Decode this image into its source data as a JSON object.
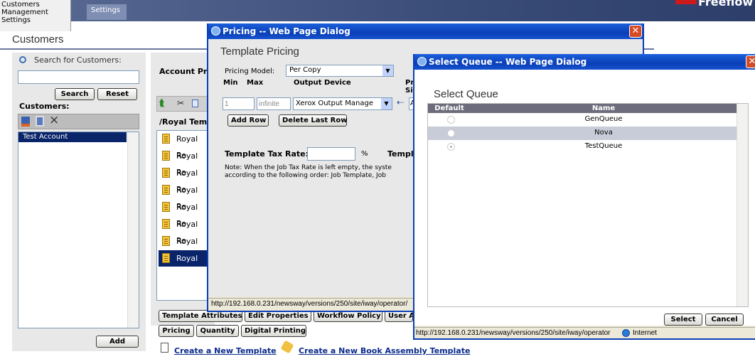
{
  "top_menu": {
    "items": [
      "Customers",
      "Management",
      "Settings"
    ],
    "settings_tab": "Settings",
    "brand_fragment": "Freeflow"
  },
  "page": {
    "title": "Customers"
  },
  "left_panel": {
    "search_label": "Search for Customers:",
    "search_value": "",
    "search_button": "Search",
    "reset_button": "Reset",
    "customers_label": "Customers:",
    "customers": [
      "Test Account"
    ],
    "add_button": "Add"
  },
  "middle_panel": {
    "account_header": "Account Pr",
    "path": "/Royal Tem",
    "templates": [
      "Royal Re",
      "Royal Re",
      "Royal Re",
      "Royal Re",
      "Royal Re",
      "Royal Re",
      "Royal Re",
      "Royal Re"
    ],
    "tabs_row1": [
      "Template Attributes",
      "Edit Properties",
      "Workflow Policy",
      "User A"
    ],
    "tabs_row2": [
      "Pricing",
      "Quantity",
      "Digital Printing"
    ],
    "create_template": "Create a New Template",
    "create_book": "Create a New Book Assembly Template"
  },
  "pricing_dialog": {
    "window_title": "Pricing -- Web Page Dialog",
    "heading": "Template Pricing",
    "model_label": "Pricing Model:",
    "model_value": "Per Copy",
    "col_min": "Min",
    "col_max": "Max",
    "col_device": "Output Device",
    "col_pr": "Pr",
    "col_si": "Si",
    "min_value": "1",
    "max_value": "infinite",
    "device_value": "Xerox Output Manage",
    "cut_value": "A",
    "add_row": "Add Row",
    "delete_row": "Delete Last Row",
    "tax_label": "Template Tax Rate:",
    "tax_unit": "%",
    "tax_right": "Templ",
    "note_line1": "Note: When the Job Tax Rate is left empty, the syste",
    "note_line2": "according to the following order: Job Template, Job",
    "status_url": "http://192.168.0.231/newsway/versions/250/site/iway/operator/"
  },
  "queue_dialog": {
    "window_title": "Select Queue -- Web Page Dialog",
    "heading": "Select Queue",
    "col_default": "Default",
    "col_name": "Name",
    "rows": [
      {
        "name": "GenQueue",
        "checked": false
      },
      {
        "name": "Nova",
        "checked": false
      },
      {
        "name": "TestQueue",
        "checked": true
      }
    ],
    "select_button": "Select",
    "cancel_button": "Cancel",
    "status_url": "http://192.168.0.231/newsway/versions/250/site/iway/operator",
    "status_zone": "Internet"
  }
}
